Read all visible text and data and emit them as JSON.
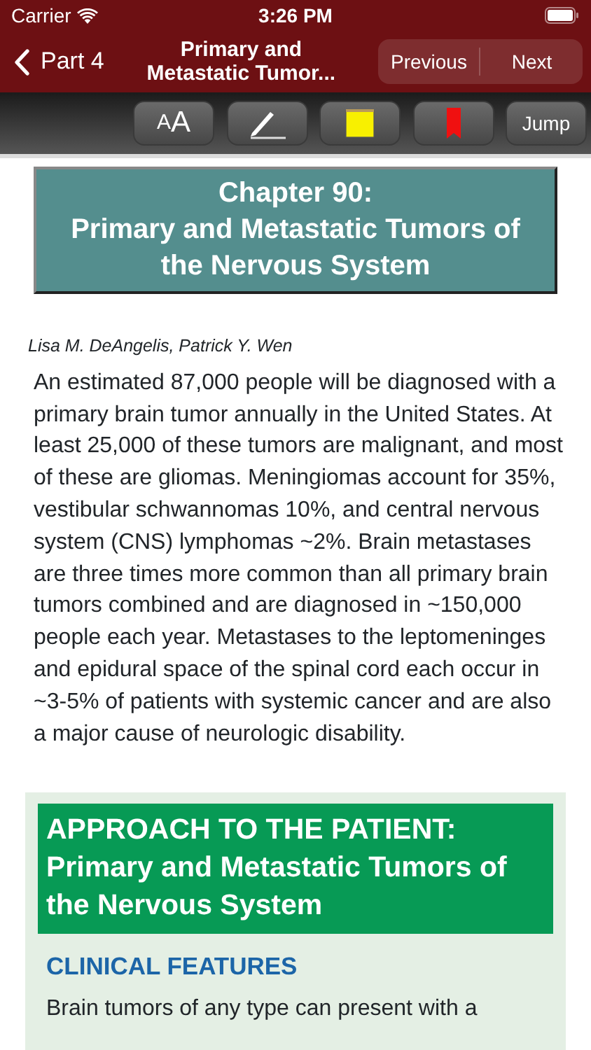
{
  "status_bar": {
    "carrier": "Carrier",
    "time": "3:26 PM"
  },
  "nav": {
    "back": "Part 4",
    "title": "Primary and Metastatic Tumor...",
    "segments": [
      {
        "label": "Previous"
      },
      {
        "label": "Next"
      }
    ]
  },
  "toolbar": {
    "font_button": "AA",
    "jump": "Jump"
  },
  "chapter": {
    "heading": [
      "Chapter 90:",
      "Primary and Metastatic Tumors of the Nervous System"
    ],
    "authors": "Lisa M. DeAngelis, Patrick Y. Wen",
    "intro": "An estimated 87,000 people will be diagnosed with a primary brain tumor annually in the United States. At least 25,000 of these tumors are malignant, and most of these are gliomas. Meningiomas account for 35%, vestibular schwannomas 10%, and central nervous system (CNS) lymphomas ~2%. Brain metastases are three times more common than all primary brain tumors combined and are diagnosed in ~150,000 people each year. Metastases to the leptomeninges and epidural space of the spinal cord each occur in ~3-5% of patients with systemic cancer and are also a major cause of neurologic disability."
  },
  "approach": {
    "heading": "APPROACH TO THE PATIENT: Primary and Metastatic Tumors of the Nervous System",
    "subheading": "CLINICAL FEATURES",
    "text": "Brain tumors of any type can present with a"
  }
}
